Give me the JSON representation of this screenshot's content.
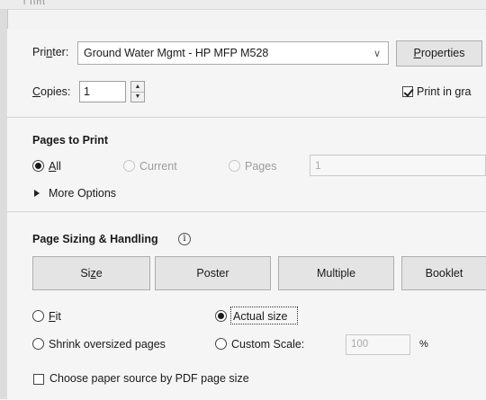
{
  "window": {
    "title_glyph": "l ıınt"
  },
  "printer": {
    "label_pre": "Pri",
    "label_accel": "n",
    "label_post": "ter:",
    "selected": "Ground Water Mgmt - HP MFP M528",
    "properties_pre": "",
    "properties_accel": "P",
    "properties_post": "roperties"
  },
  "copies": {
    "label_accel": "C",
    "label_post": "opies:",
    "value": "1"
  },
  "print_in_gray": {
    "label": "Print in gra",
    "checked": true
  },
  "pages_to_print": {
    "title": "Pages to Print",
    "all_accel": "A",
    "all_post": "ll",
    "current": "Current",
    "pages": "Pages",
    "pages_value": "1",
    "more_options": "More Options"
  },
  "page_sizing": {
    "title": "Page Sizing & Handling",
    "info_icon": "i",
    "tabs": [
      {
        "pre": "Si",
        "accel": "z",
        "post": "e"
      },
      {
        "pre": "",
        "accel": "",
        "post": "Poster"
      },
      {
        "pre": "",
        "accel": "",
        "post": "Multiple"
      },
      {
        "pre": "",
        "accel": "",
        "post": "Booklet"
      }
    ],
    "fit_accel": "F",
    "fit_post": "it",
    "actual_size": "Actual size",
    "shrink": "Shrink oversized pages",
    "custom_scale": "Custom Scale:",
    "scale_value": "100",
    "percent": "%",
    "choose_paper": "Choose paper source by PDF page size"
  }
}
